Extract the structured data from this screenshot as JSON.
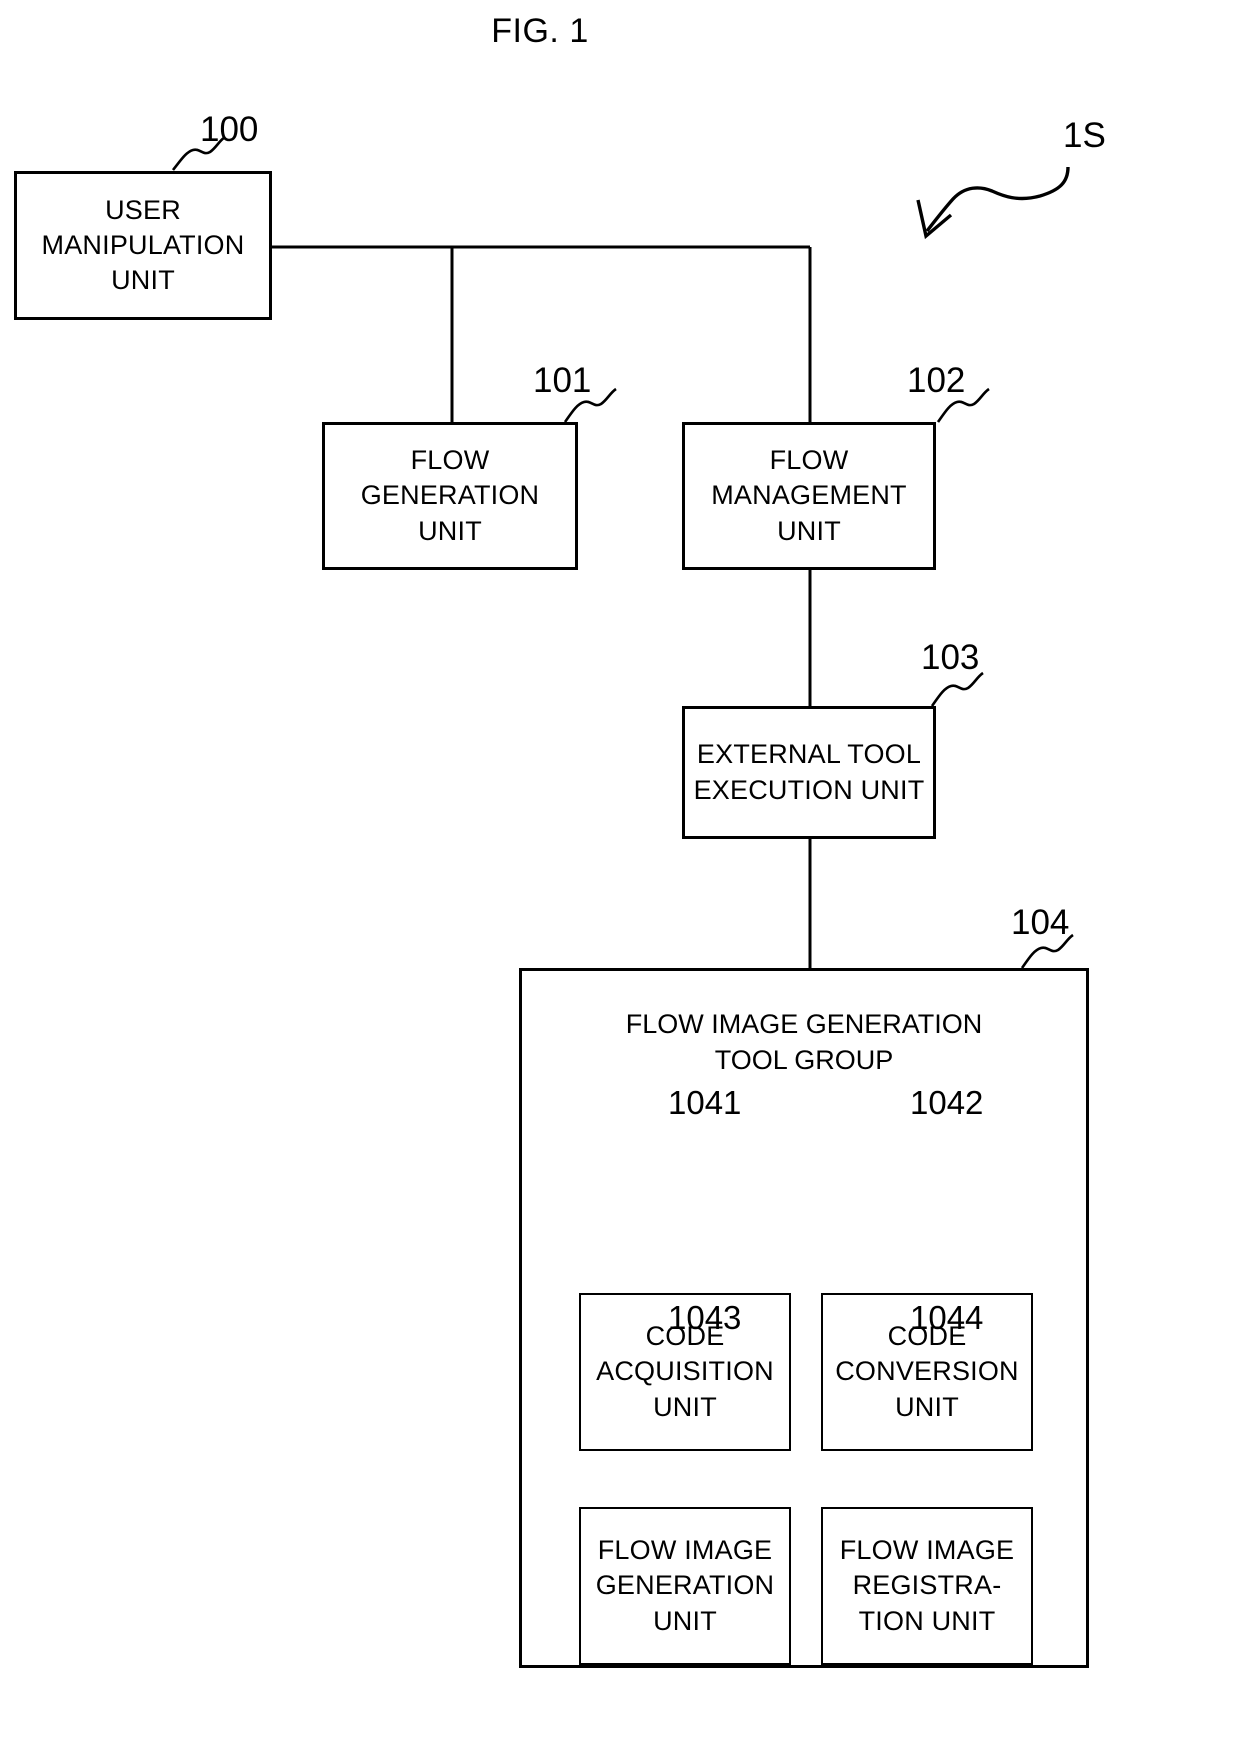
{
  "figure": {
    "title": "FIG. 1",
    "system_label": "1S"
  },
  "blocks": [
    {
      "ref": "100",
      "label": "USER\nMANIPULATION\nUNIT"
    },
    {
      "ref": "101",
      "label": "FLOW\nGENERATION\nUNIT"
    },
    {
      "ref": "102",
      "label": "FLOW\nMANAGEMENT\nUNIT"
    },
    {
      "ref": "103",
      "label": "EXTERNAL TOOL\nEXECUTION UNIT"
    },
    {
      "ref": "104",
      "label": "FLOW IMAGE GENERATION\nTOOL GROUP"
    },
    {
      "ref": "1041",
      "label": "CODE\nACQUISITION\nUNIT"
    },
    {
      "ref": "1042",
      "label": "CODE\nCONVERSION\nUNIT"
    },
    {
      "ref": "1043",
      "label": "FLOW IMAGE\nGENERATION\nUNIT"
    },
    {
      "ref": "1044",
      "label": "FLOW IMAGE\nREGISTRA-\nTION UNIT"
    }
  ],
  "colors": {
    "stroke": "#000000",
    "background": "#ffffff"
  }
}
